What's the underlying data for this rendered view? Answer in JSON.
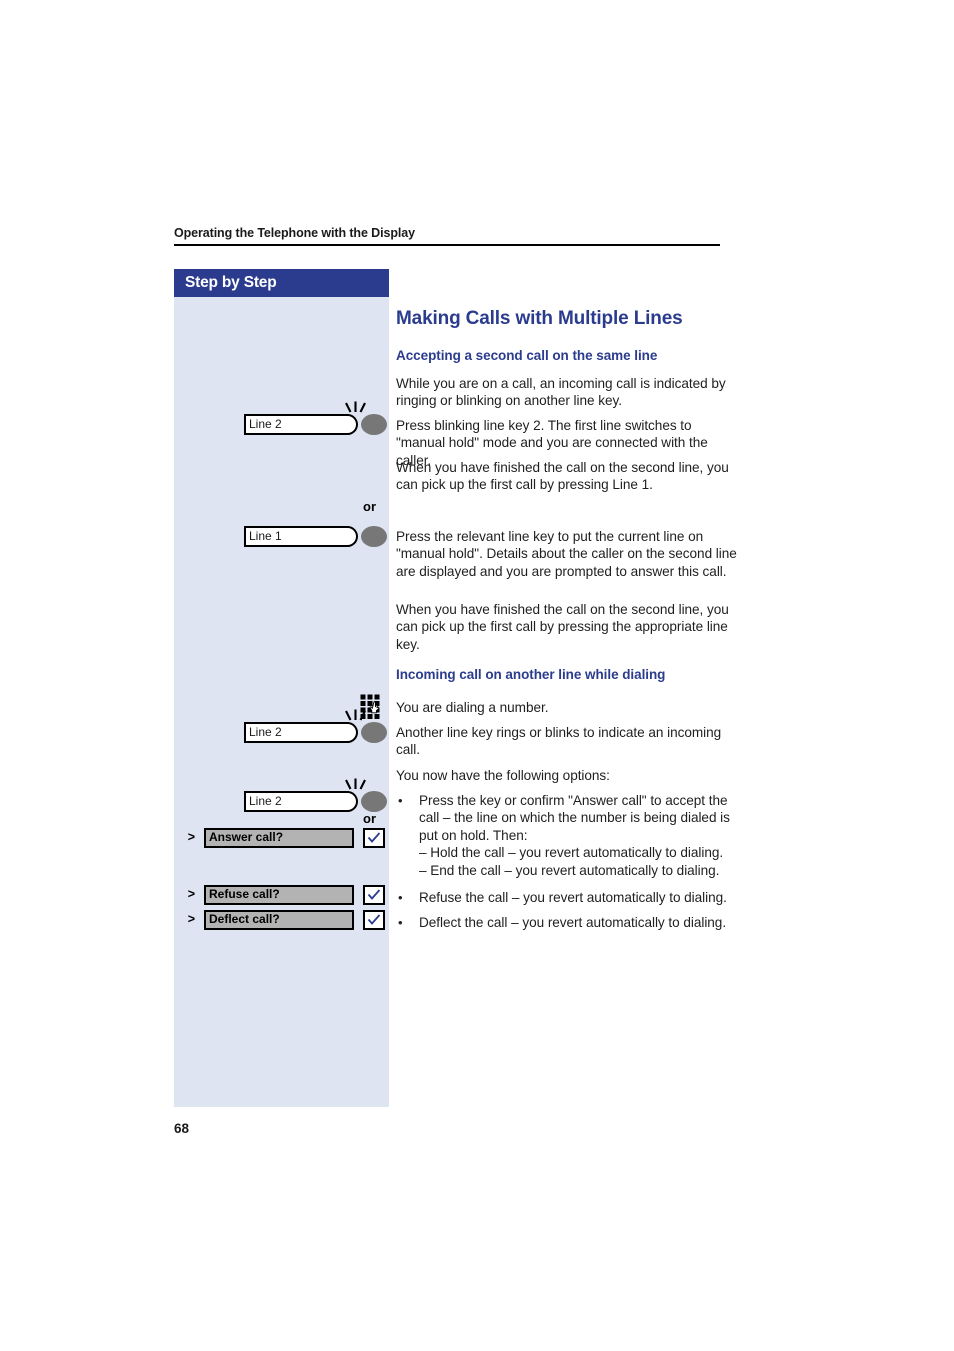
{
  "page": {
    "running_head": "Operating the Telephone with the Display",
    "folio": "68",
    "colors": {
      "accent_navy": "#2b3c8e",
      "sidebar_bg": "#dfe4f2",
      "softkey_gray": "#b3b3b3",
      "led_gray": "#777777",
      "body_text": "#1f1f1f"
    }
  },
  "sidebar": {
    "title": "Step by Step",
    "items": [
      {
        "type": "line-key",
        "label": "Line 2",
        "blinking": true,
        "icon": "line-key-blinking-icon"
      },
      {
        "type": "line-key",
        "label": "Line 1",
        "blinking": false,
        "icon": "line-key-icon"
      },
      {
        "type": "keypad",
        "icon": "keypad-hand-icon"
      },
      {
        "type": "line-key",
        "label": "Line 2",
        "blinking": true,
        "icon": "line-key-blinking-icon"
      },
      {
        "type": "line-key",
        "label": "Line 2",
        "blinking": true,
        "icon": "line-key-blinking-icon"
      },
      {
        "type": "softkey",
        "label": "Answer call?",
        "arrow": ">",
        "confirm_icon": "checkmark-icon"
      },
      {
        "type": "softkey",
        "label": "Refuse call?",
        "arrow": ">",
        "confirm_icon": "checkmark-icon"
      },
      {
        "type": "softkey",
        "label": "Deflect call?",
        "arrow": ">",
        "confirm_icon": "checkmark-icon"
      }
    ],
    "or_labels": [
      "or",
      "or"
    ]
  },
  "main": {
    "title": "Making Calls with Multiple Lines",
    "section1": {
      "heading": "Accepting a second call on the same line",
      "paragraphs": [
        "While you are on a call, an incoming call is indicated by ringing or blinking on another line key.",
        "Press blinking line key 2. The first line switches to \"manual hold\" mode and you are connected with the caller.",
        "When you have finished the call on the second line, you can pick up the first call by pressing Line 1.",
        "Press the relevant line key to put the current line on \"manual hold\". Details about the caller on the second line are displayed and you are prompted to answer this call.",
        "When you have finished the call on the second line, you can pick up the first call by pressing the appropriate line key."
      ]
    },
    "section2": {
      "heading": "Incoming call on another line while dialing",
      "paragraphs": [
        "You are dialing a number.",
        "Another line key rings or blinks to indicate an incoming call.",
        "You now have the following options:"
      ],
      "bullets": [
        {
          "text": "Press the key or confirm \"Answer call\"  to accept the call – the line on which the number is being dialed is put on hold. Then:",
          "subitems": [
            "– Hold the call – you revert automatically to dialing.",
            "– End the call – you revert automatically to dialing."
          ]
        },
        {
          "text": "Refuse the call – you revert automatically to dialing.",
          "subitems": []
        },
        {
          "text": "Deflect the call – you revert automatically to dialing.",
          "subitems": []
        }
      ]
    }
  }
}
